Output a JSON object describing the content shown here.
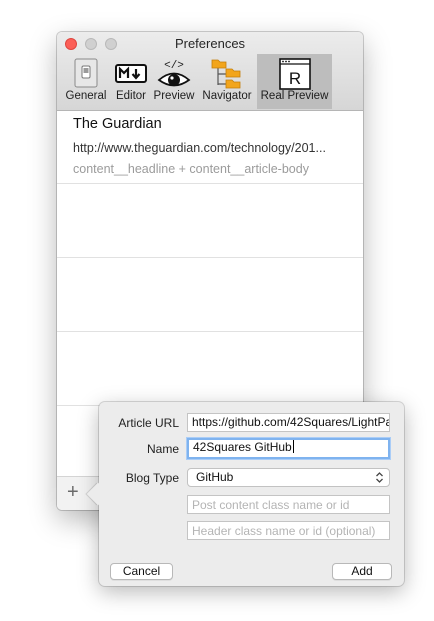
{
  "window": {
    "title": "Preferences"
  },
  "toolbar": {
    "tabs": [
      {
        "label": "General",
        "icon": "general-switch-icon"
      },
      {
        "label": "Editor",
        "icon": "markdown-icon"
      },
      {
        "label": "Preview",
        "icon": "eye-code-icon"
      },
      {
        "label": "Navigator",
        "icon": "folder-tree-icon"
      },
      {
        "label": "Real Preview",
        "icon": "real-preview-icon",
        "selected": true
      }
    ]
  },
  "list": {
    "items": [
      {
        "title": "The Guardian",
        "url": "http://www.theguardian.com/technology/201...",
        "classes": "content__headline + content__article-body"
      }
    ]
  },
  "bottombar": {
    "add_symbol": "+"
  },
  "popover": {
    "article_url_label": "Article URL",
    "article_url_value": "https://github.com/42Squares/LightPa",
    "name_label": "Name",
    "name_value": "42Squares GitHub",
    "blog_type_label": "Blog Type",
    "blog_type_value": "GitHub",
    "post_class_placeholder": "Post content class name or id",
    "header_class_placeholder": "Header class name or id (optional)",
    "cancel_label": "Cancel",
    "add_label": "Add"
  },
  "colors": {
    "close_button": "#fc5f57",
    "focus_ring": "#7fb3ef"
  }
}
